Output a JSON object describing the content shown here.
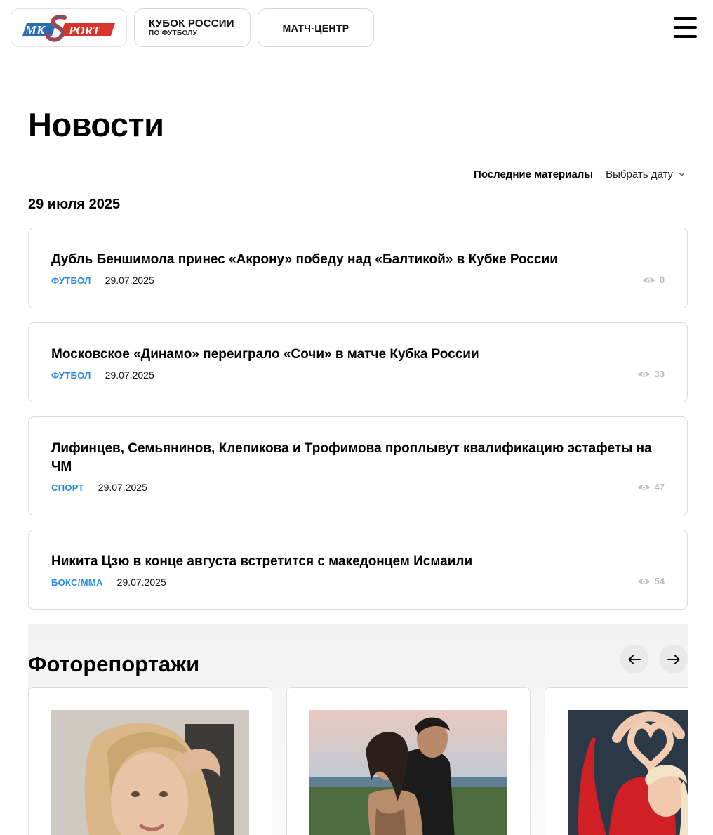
{
  "header": {
    "logo_alt": "MK SPORT",
    "cup_line1": "КУБОК РОССИИ",
    "cup_line2": "ПО ФУТБОЛУ",
    "match_center": "МАТЧ-ЦЕНТР",
    "menu_icon": "burger-menu-icon"
  },
  "page": {
    "title": "Новости",
    "filter_latest": "Последние материалы",
    "filter_date": "Выбрать дату",
    "date_heading": "29 июля 2025"
  },
  "news": [
    {
      "title": "Дубль Беншимола принес «Акрону» победу над «Балтикой» в Кубке России",
      "category": "ФУТБОЛ",
      "date": "29.07.2025",
      "views": "0"
    },
    {
      "title": "Московское «Динамо» переиграло «Сочи» в матче Кубка России",
      "category": "ФУТБОЛ",
      "date": "29.07.2025",
      "views": "33"
    },
    {
      "title": "Лифинцев, Семьянинов, Клепикова и Трофимова проплывут квалификацию эстафеты на ЧМ",
      "category": "СПОРТ",
      "date": "29.07.2025",
      "views": "47"
    },
    {
      "title": "Никита Цзю в конце августа встретится с македонцем Исмаили",
      "category": "БОКС/ММА",
      "date": "29.07.2025",
      "views": "54"
    }
  ],
  "photos": {
    "title": "Фоторепортажи",
    "prev_icon": "arrow-left-icon",
    "next_icon": "arrow-right-icon"
  },
  "colors": {
    "accent_category": "#2a8be0",
    "logo_blue": "#2b6cb0",
    "logo_red": "#d9342b"
  }
}
